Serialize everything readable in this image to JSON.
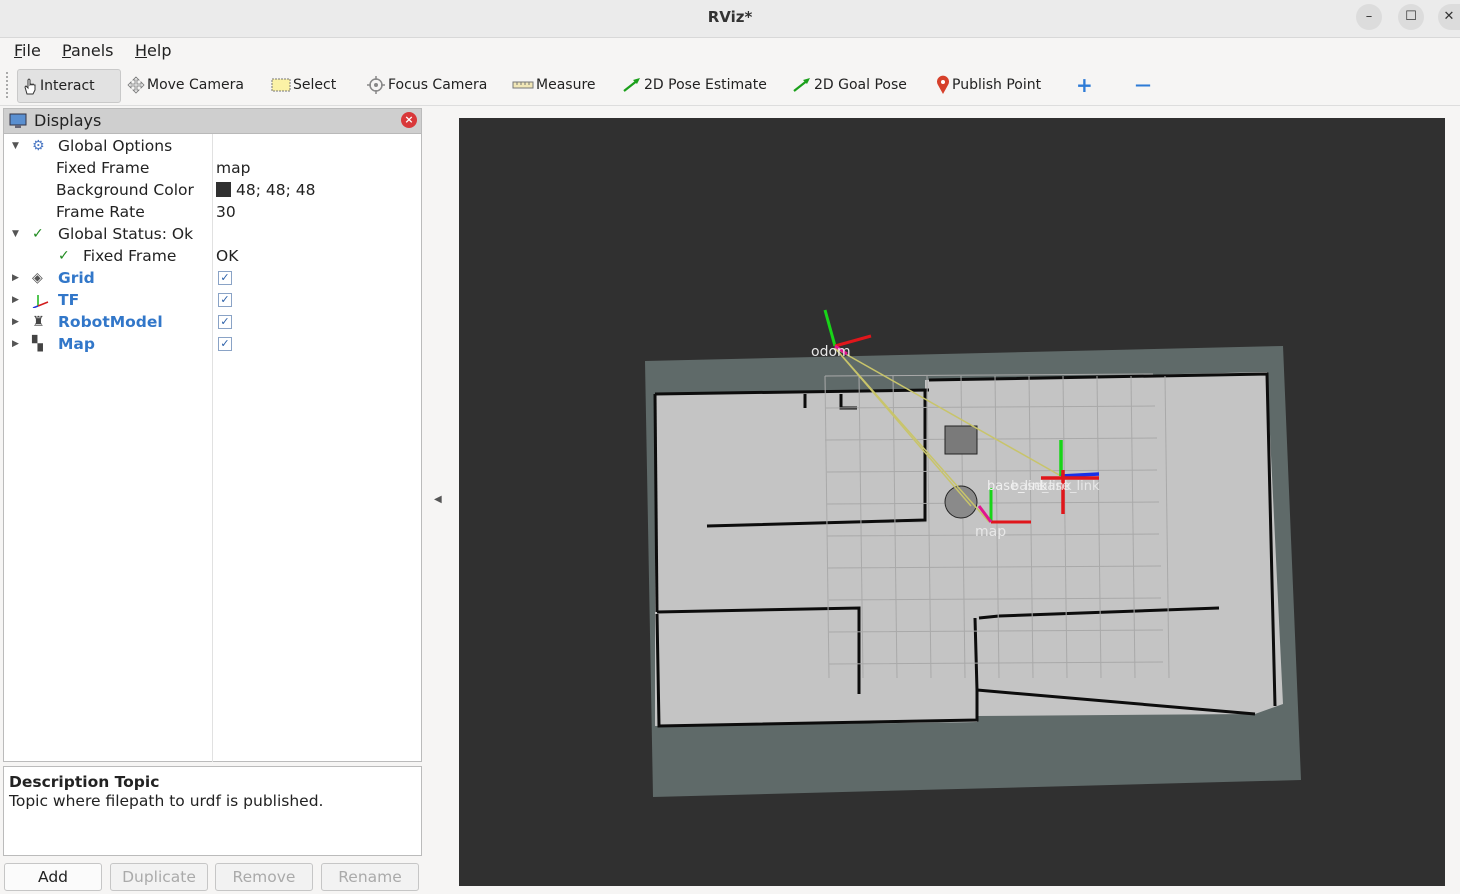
{
  "window": {
    "title": "RViz*",
    "minimize": "–",
    "maximize": "☐",
    "close": "✕"
  },
  "menu": {
    "file_u": "F",
    "file_rest": "ile",
    "panels_u": "P",
    "panels_rest": "anels",
    "help_u": "H",
    "help_rest": "elp"
  },
  "toolbar": {
    "interact": "Interact",
    "move_camera": "Move Camera",
    "select": "Select",
    "focus_camera": "Focus Camera",
    "measure": "Measure",
    "pose_estimate": "2D Pose Estimate",
    "goal_pose": "2D Goal Pose",
    "publish_point": "Publish Point",
    "add_tool": "+",
    "remove_tool": "—"
  },
  "displays": {
    "title": "Displays",
    "global_options": "Global Options",
    "fixed_frame_label": "Fixed Frame",
    "fixed_frame_value": "map",
    "bg_color_label": "Background Color",
    "bg_color_value": "48; 48; 48",
    "bg_color_hex": "#303030",
    "frame_rate_label": "Frame Rate",
    "frame_rate_value": "30",
    "global_status": "Global Status: Ok",
    "status_fixed_frame": "Fixed Frame",
    "status_fixed_frame_value": "OK",
    "items": [
      {
        "name": "Grid",
        "checked": true
      },
      {
        "name": "TF",
        "checked": true
      },
      {
        "name": "RobotModel",
        "checked": true
      },
      {
        "name": "Map",
        "checked": true
      }
    ]
  },
  "description": {
    "heading": "Description Topic",
    "body": "Topic where filepath to urdf is published."
  },
  "buttons": {
    "add": "Add",
    "duplicate": "Duplicate",
    "remove": "Remove",
    "rename": "Rename"
  },
  "viewport": {
    "odom_label": "odom",
    "map_label": "map",
    "base_labels": "base_link",
    "colors": {
      "background": "#303030",
      "map_unknown": "#5f6a69",
      "map_free": "#c4c4c4",
      "wall": "#0c0c0c",
      "x_axis": "#e0161b",
      "y_axis": "#18d418",
      "z_axis": "#1830e8",
      "tf_line": "#c8c46a"
    }
  }
}
